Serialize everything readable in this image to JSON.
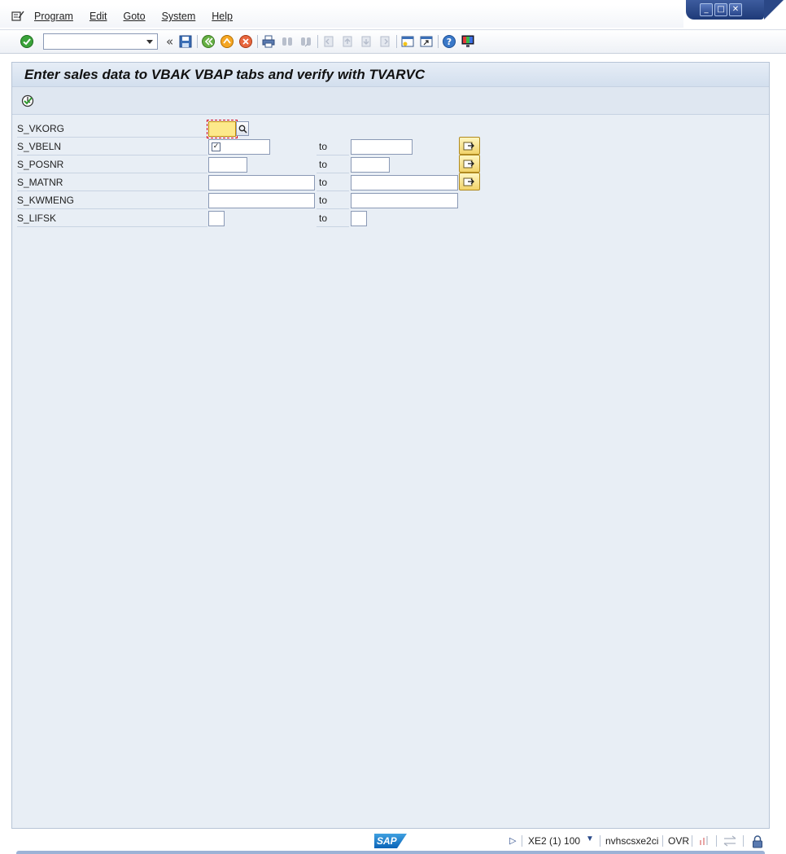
{
  "window": {
    "controls": [
      "minimize",
      "maximize",
      "close"
    ]
  },
  "menubar": {
    "items": [
      {
        "label": "Program"
      },
      {
        "label": "Edit"
      },
      {
        "label": "Goto"
      },
      {
        "label": "System"
      },
      {
        "label": "Help"
      }
    ]
  },
  "toolbar": {
    "command_field_value": "",
    "collapse_glyph": "«",
    "icons": [
      "enter-icon",
      "save-icon",
      "back-icon",
      "exit-icon",
      "cancel-icon",
      "print-icon",
      "find-icon",
      "find-next-icon",
      "first-page-icon",
      "previous-page-icon",
      "next-page-icon",
      "last-page-icon",
      "create-session-icon",
      "shortcut-icon",
      "help-icon",
      "customize-layout-icon"
    ]
  },
  "screen": {
    "title": "Enter sales data to VBAK VBAP tabs and verify with TVARVC",
    "app_toolbar_icons": [
      "execute-icon"
    ]
  },
  "selection": {
    "to_label": "to",
    "rows": [
      {
        "label": "S_VKORG",
        "low": "",
        "high": null
      },
      {
        "label": "S_VBELN",
        "low": "",
        "high": "",
        "checkbox_checked": true
      },
      {
        "label": "S_POSNR",
        "low": "",
        "high": ""
      },
      {
        "label": "S_MATNR",
        "low": "",
        "high": ""
      },
      {
        "label": "S_KWMENG",
        "low": "",
        "high": ""
      },
      {
        "label": "S_LIFSK",
        "low": "",
        "high": ""
      }
    ]
  },
  "statusbar": {
    "logo": "SAP",
    "system": "XE2 (1) 100",
    "server": "nvhscsxe2ci",
    "mode": "OVR"
  },
  "colors": {
    "panel_bg": "#e8eef5",
    "required_field": "#fde98b",
    "accent_blue": "#1e3a78"
  }
}
